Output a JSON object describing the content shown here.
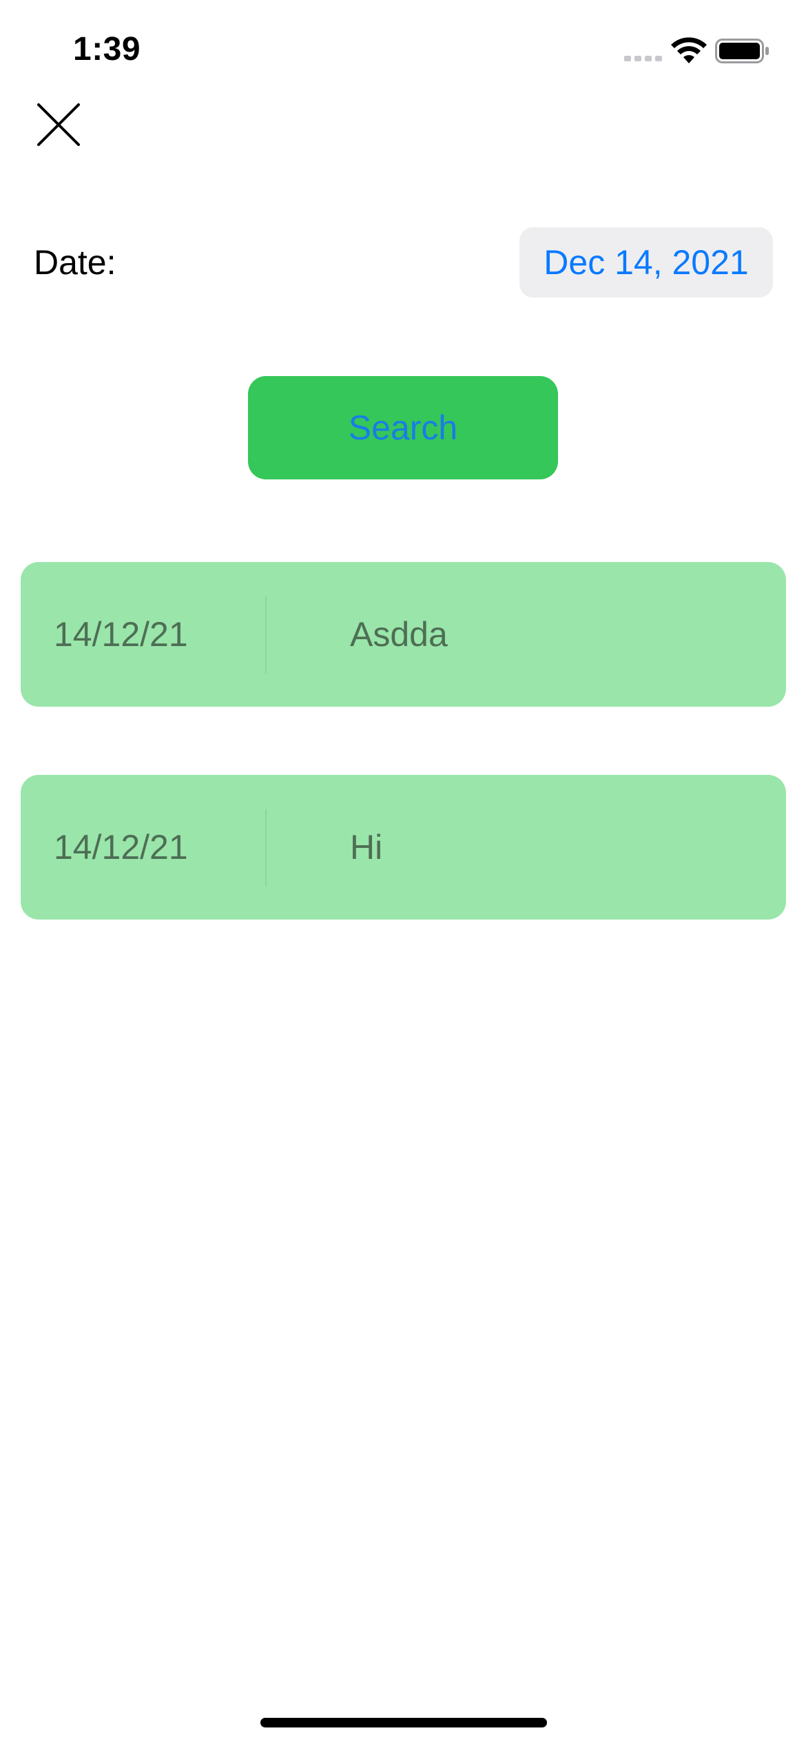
{
  "status_bar": {
    "time": "1:39"
  },
  "header": {
    "close_icon": "close-icon"
  },
  "date_row": {
    "label": "Date:",
    "value": "Dec 14, 2021"
  },
  "search": {
    "label": "Search"
  },
  "results": [
    {
      "date": "14/12/21",
      "text": "Asdda"
    },
    {
      "date": "14/12/21",
      "text": "Hi"
    }
  ],
  "colors": {
    "accent_blue": "#0a7aff",
    "button_green": "#35c759",
    "row_green": "#9ae5aa",
    "row_text": "#4d6e54"
  }
}
